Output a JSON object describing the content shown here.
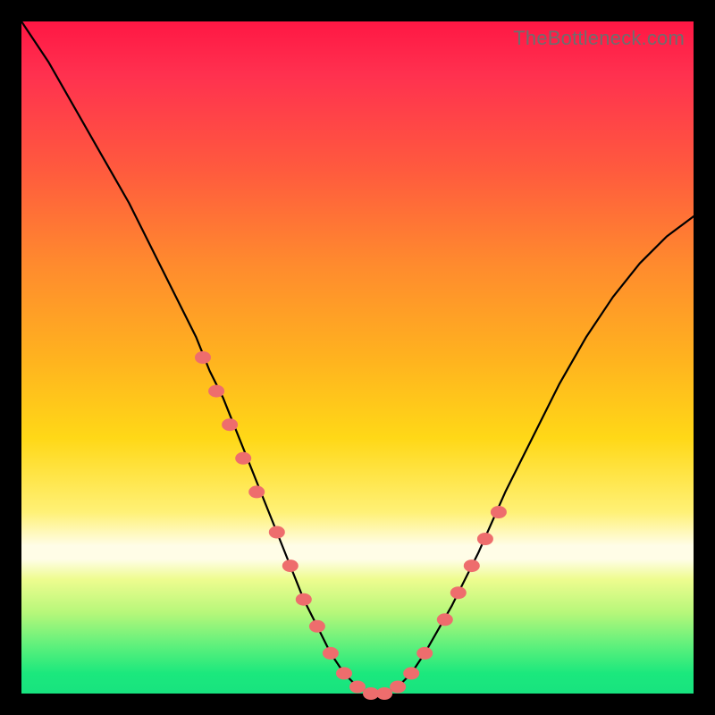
{
  "attribution": "TheBottleneck.com",
  "colors": {
    "background": "#000000",
    "curve": "#000000",
    "beads": "#ee6d6d",
    "gradient_stops": [
      "#ff1744",
      "#ff5a3e",
      "#ffb21f",
      "#fff176",
      "#fffde7",
      "#5cf07c",
      "#18e37f"
    ]
  },
  "chart_data": {
    "type": "line",
    "title": "",
    "xlabel": "",
    "ylabel": "",
    "xlim": [
      0,
      100
    ],
    "ylim": [
      0,
      100
    ],
    "grid": false,
    "legend_position": "none",
    "annotations": [
      "TheBottleneck.com"
    ],
    "series": [
      {
        "name": "bottleneck-curve",
        "x": [
          0,
          4,
          8,
          12,
          16,
          20,
          24,
          26,
          28,
          30,
          32,
          34,
          36,
          38,
          40,
          42,
          44,
          46,
          48,
          50,
          52,
          54,
          56,
          58,
          60,
          64,
          68,
          72,
          76,
          80,
          84,
          88,
          92,
          96,
          100
        ],
        "y": [
          100,
          94,
          87,
          80,
          73,
          65,
          57,
          53,
          48,
          44,
          39,
          34,
          29,
          24,
          19,
          14,
          10,
          6,
          3,
          1,
          0,
          0,
          1,
          3,
          6,
          13,
          21,
          30,
          38,
          46,
          53,
          59,
          64,
          68,
          71
        ]
      }
    ],
    "markers": [
      {
        "name": "bead",
        "x": 27,
        "y": 50
      },
      {
        "name": "bead",
        "x": 29,
        "y": 45
      },
      {
        "name": "bead",
        "x": 31,
        "y": 40
      },
      {
        "name": "bead",
        "x": 33,
        "y": 35
      },
      {
        "name": "bead",
        "x": 35,
        "y": 30
      },
      {
        "name": "bead",
        "x": 38,
        "y": 24
      },
      {
        "name": "bead",
        "x": 40,
        "y": 19
      },
      {
        "name": "bead",
        "x": 42,
        "y": 14
      },
      {
        "name": "bead",
        "x": 44,
        "y": 10
      },
      {
        "name": "bead",
        "x": 46,
        "y": 6
      },
      {
        "name": "bead",
        "x": 48,
        "y": 3
      },
      {
        "name": "bead",
        "x": 50,
        "y": 1
      },
      {
        "name": "bead",
        "x": 52,
        "y": 0
      },
      {
        "name": "bead",
        "x": 54,
        "y": 0
      },
      {
        "name": "bead",
        "x": 56,
        "y": 1
      },
      {
        "name": "bead",
        "x": 58,
        "y": 3
      },
      {
        "name": "bead",
        "x": 60,
        "y": 6
      },
      {
        "name": "bead",
        "x": 63,
        "y": 11
      },
      {
        "name": "bead",
        "x": 65,
        "y": 15
      },
      {
        "name": "bead",
        "x": 67,
        "y": 19
      },
      {
        "name": "bead",
        "x": 69,
        "y": 23
      },
      {
        "name": "bead",
        "x": 71,
        "y": 27
      }
    ]
  }
}
